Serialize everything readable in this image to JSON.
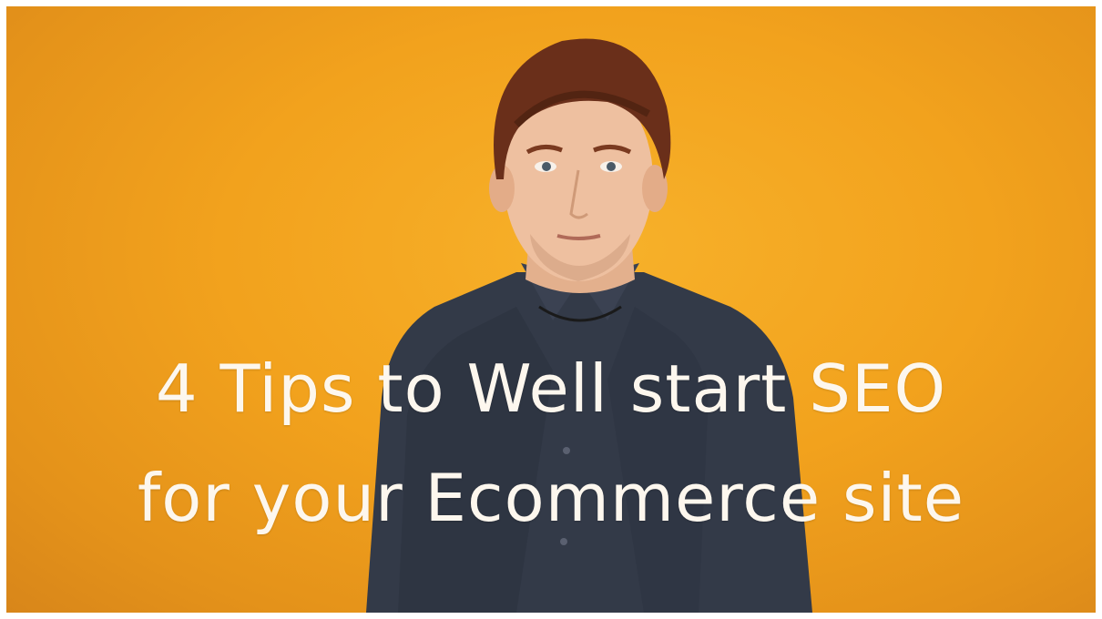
{
  "video": {
    "title_line_1": "4 Tips to Well start SEO",
    "title_line_2": "for your Ecommerce site",
    "background_color": "#f2a21d",
    "text_color": "#fdf7ee",
    "shirt_color": "#333a48"
  }
}
